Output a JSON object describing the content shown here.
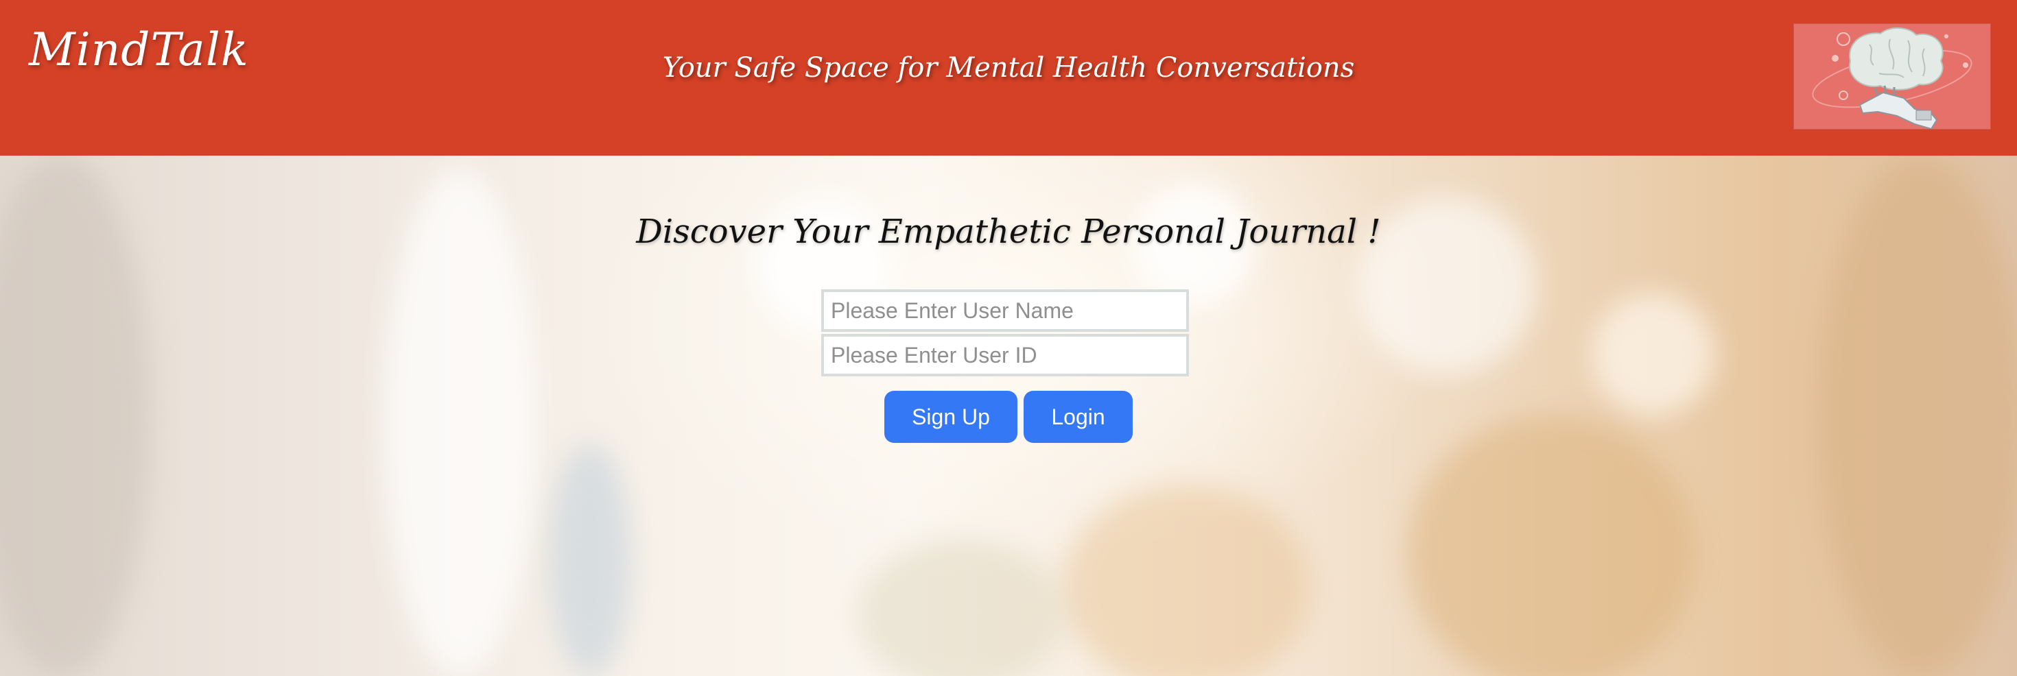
{
  "header": {
    "brand": "MindTalk",
    "tagline": "Your Safe Space for Mental Health Conversations",
    "logo_icon": "brain-robot-hand-icon"
  },
  "main": {
    "heading": "Discover Your Empathetic Personal Journal !",
    "username_field": {
      "value": "",
      "placeholder": "Please Enter User Name"
    },
    "userid_field": {
      "value": "",
      "placeholder": "Please Enter User ID"
    },
    "signup_label": "Sign Up",
    "login_label": "Login"
  },
  "colors": {
    "header_bg": "#d44126",
    "button_bg": "#3478f6",
    "button_text": "#ffffff",
    "logo_bg": "#e6706a"
  }
}
